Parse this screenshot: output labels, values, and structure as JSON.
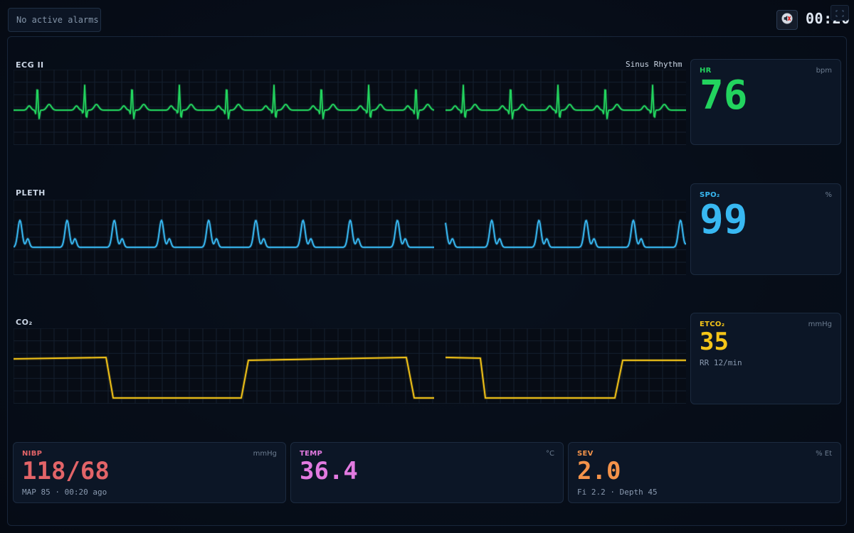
{
  "alarm": {
    "text": "No active alarms"
  },
  "header": {
    "clock": "00:20"
  },
  "colors": {
    "ecg": "#22d35e",
    "pleth": "#38b8f2",
    "co2": "#f5c518",
    "nibp": "#e26468",
    "temp": "#e27ae0",
    "sev": "#f4934a"
  },
  "icons": {
    "mute": "speaker-muted-icon"
  },
  "waveforms": {
    "ecg": {
      "label": "ECG II",
      "rhythm": "Sinus Rhythm"
    },
    "pleth": {
      "label": "PLETH"
    },
    "co2": {
      "label": "CO₂"
    }
  },
  "numerics": {
    "hr": {
      "title": "HR",
      "unit": "bpm",
      "value": "76"
    },
    "spo2": {
      "title": "SPO₂",
      "unit": "%",
      "value": "99"
    },
    "etco2": {
      "title": "ETCO₂",
      "unit": "mmHg",
      "value": "35",
      "sub": "RR 12/min"
    }
  },
  "bottom": {
    "nibp": {
      "title": "NIBP",
      "unit": "mmHg",
      "value": "118/68",
      "sub": "MAP 85 · 00:20 ago"
    },
    "temp": {
      "title": "TEMP",
      "unit": "°C",
      "value": "36.4"
    },
    "sev": {
      "title": "SEV",
      "unit": "% Et",
      "value": "2.0",
      "sub": "Fi 2.2 · Depth 45"
    }
  }
}
